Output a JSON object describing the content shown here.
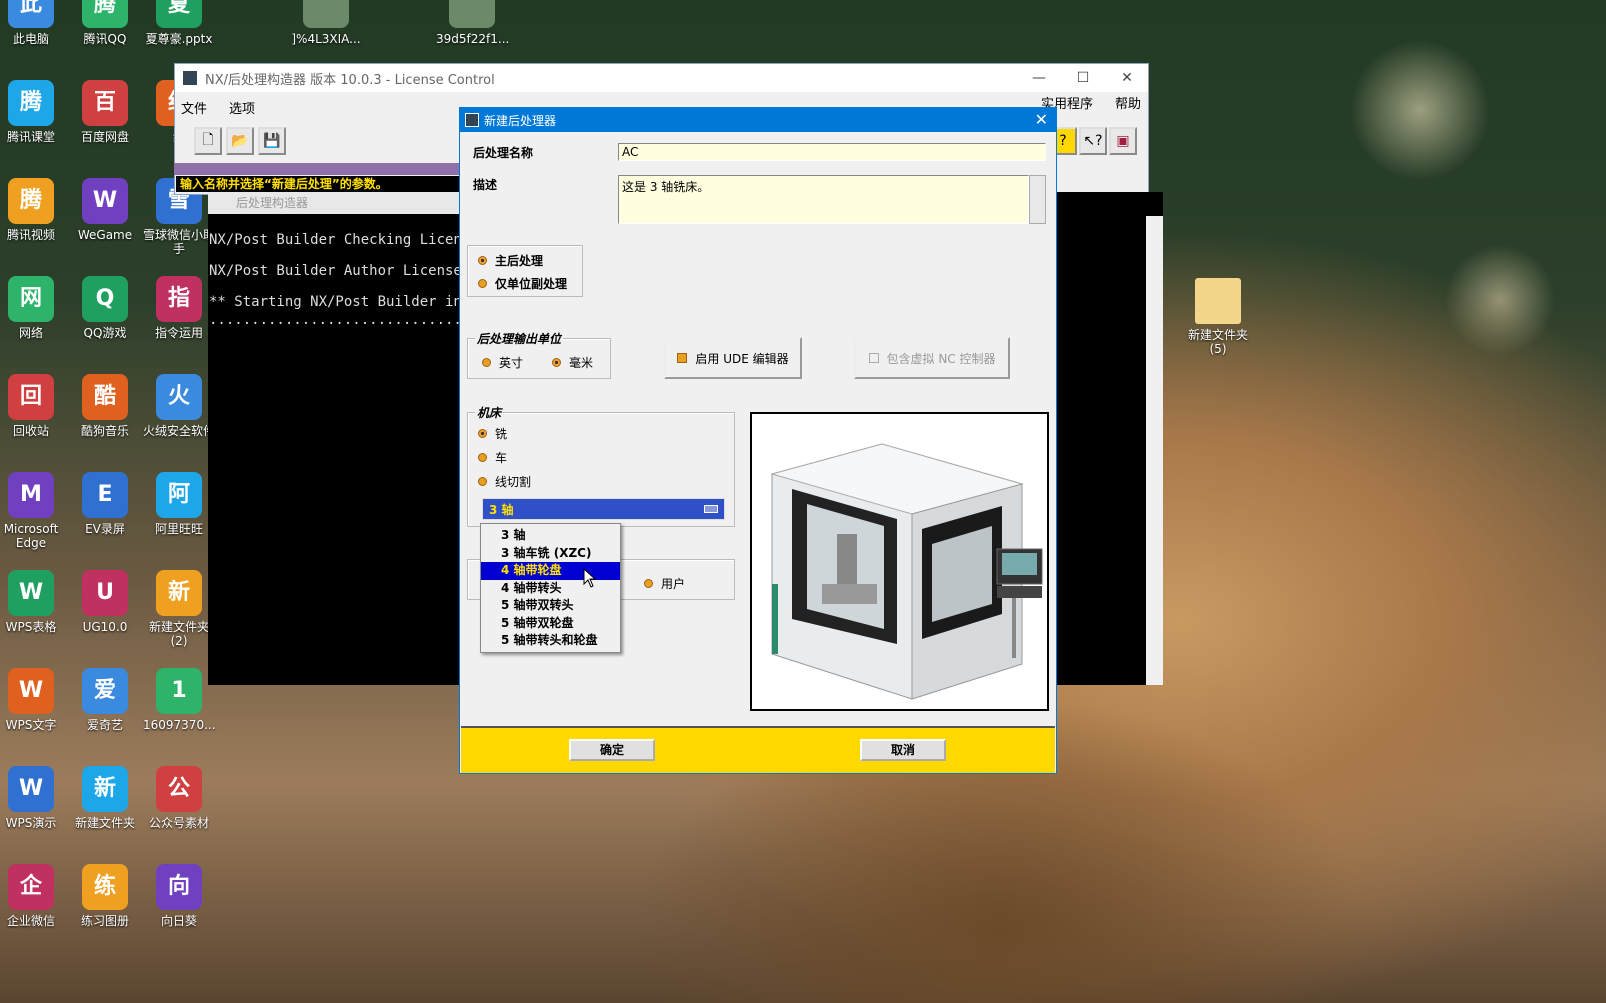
{
  "desktop": {
    "col1": [
      "此电脑",
      "腾讯课堂",
      "腾讯视频",
      "网络",
      "回收站",
      "Microsoft Edge",
      "WPS表格",
      "WPS文字",
      "WPS演示",
      "企业微信"
    ],
    "col2": [
      "腾讯QQ",
      "百度网盘",
      "WeGame",
      "QQ游戏",
      "酷狗音乐",
      "EV录屏",
      "UG10.0",
      "爱奇艺",
      "新建文件夹",
      "练习图册"
    ],
    "col3": [
      "夏尊豪.pptx",
      "红",
      "雪球微信小助手",
      "指令运用",
      "火绒安全软件",
      "阿里旺旺",
      "新建文件夹 (2)",
      "16097370...",
      "公众号素材",
      "向日葵"
    ],
    "top_extra": [
      "]%4L3XIA...",
      "39d5f22f1..."
    ],
    "right_folder": "新建文件夹 (5)"
  },
  "main_window": {
    "title": "NX/后处理构造器 版本 10.0.3 - License Control",
    "menu": [
      "文件",
      "选项"
    ],
    "menu_right": [
      "实用程序",
      "帮助"
    ],
    "hint": "输入名称并选择“新建后处理”的参数。"
  },
  "console": {
    "title": "后处理构造器",
    "lines": [
      "NX/Post Builder Checking License",
      "NX/Post Builder Author License U",
      "** Starting NX/Post Builder in D",
      "................................"
    ]
  },
  "dialog": {
    "title": "新建后处理器",
    "name_label": "后处理名称",
    "name_value": "AC",
    "desc_label": "描述",
    "desc_value": "这是 3 轴铣床。",
    "post_type": {
      "main": "主后处理",
      "unit_only": "仅单位副处理",
      "selected": "main"
    },
    "output_units": {
      "title": "后处理输出单位",
      "inch": "英寸",
      "mm": "毫米",
      "selected": "mm"
    },
    "ude_btn": "启用 UDE 编辑器",
    "vnc_btn": "包含虚拟 NC 控制器",
    "machine": {
      "title": "机床",
      "mill": "铣",
      "lathe": "车",
      "wire": "线切割",
      "selected": "mill"
    },
    "axis_selected": "3 轴",
    "axis_options": [
      "3 轴",
      "3 轴车铣 (XZC)",
      "4 轴带轮盘",
      "4 轴带转头",
      "5 轴带双转头",
      "5 轴带双轮盘",
      "5 轴带转头和轮盘"
    ],
    "highlighted_option": "4 轴带轮盘",
    "user_label": "用户",
    "ok": "确定",
    "cancel": "取消"
  }
}
